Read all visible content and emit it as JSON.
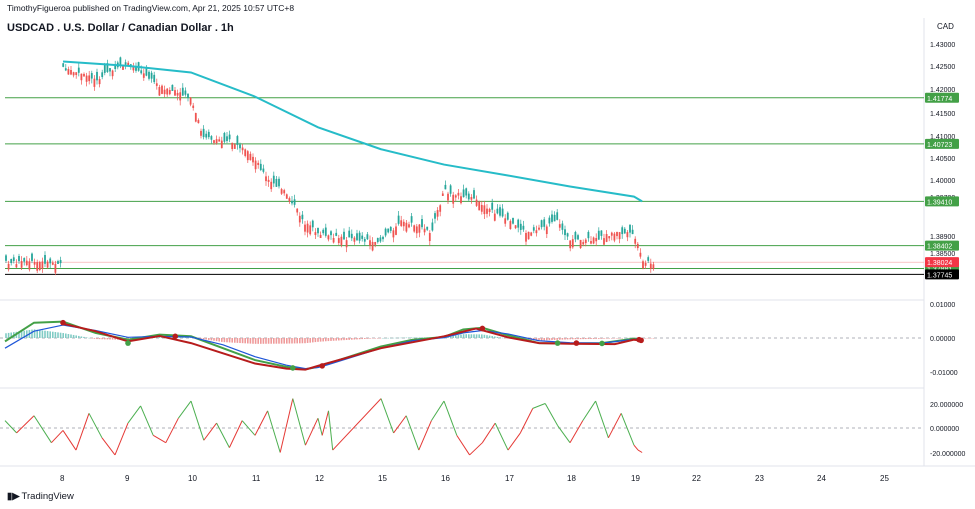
{
  "header": {
    "publisher": "TimothyFigueroa published on TradingView.com, Apr 21, 2025 10:57 UTC+8",
    "title": "USDCAD . U.S. Dollar / Canadian Dollar . 1h",
    "currency": "CAD",
    "brand": "TradingView"
  },
  "colors": {
    "up": "#26a69a",
    "down": "#ef5350",
    "ma": "#26bcc8",
    "level": "#43a047",
    "last": "#f23645",
    "rsi_up": "#4caf50",
    "rsi_down": "#e53935"
  },
  "chart_data": [
    {
      "type": "candlestick",
      "title": "USDCAD . U.S. Dollar / Canadian Dollar . 1h",
      "x_tick_labels": [
        "8",
        "9",
        "10",
        "11",
        "12",
        "15",
        "16",
        "17",
        "18",
        "19",
        "22",
        "23",
        "24",
        "25"
      ],
      "y_tick_labels": [
        "1.43000",
        "1.42500",
        "1.42000",
        "1.41500",
        "1.41000",
        "1.40500",
        "1.40000",
        "1.39700",
        "1.38900",
        "1.38500",
        "1.37800"
      ],
      "ylim": [
        1.3765,
        1.4315
      ],
      "close_path": [
        [
          "8",
          1.4245
        ],
        [
          "8.5",
          1.422
        ],
        [
          "9",
          1.4255
        ],
        [
          "9.5",
          1.4205
        ],
        [
          "10",
          1.4175
        ],
        [
          "10.2",
          1.4085
        ],
        [
          "10.6",
          1.408
        ],
        [
          "11",
          1.404
        ],
        [
          "11.2",
          1.399
        ],
        [
          "11.5",
          1.396
        ],
        [
          "11.8",
          1.389
        ],
        [
          "12",
          1.387
        ],
        [
          "12.5",
          1.386
        ],
        [
          "15",
          1.385
        ],
        [
          "15.3",
          1.3895
        ],
        [
          "15.6",
          1.3885
        ],
        [
          "15.8",
          1.387
        ],
        [
          "16",
          1.3965
        ],
        [
          "16.3",
          1.3955
        ],
        [
          "16.6",
          1.3935
        ],
        [
          "17",
          1.3895
        ],
        [
          "17.3",
          1.387
        ],
        [
          "17.8",
          1.3895
        ],
        [
          "18",
          1.385
        ],
        [
          "18.4",
          1.3855
        ],
        [
          "18.7",
          1.387
        ],
        [
          "19",
          1.3865
        ],
        [
          "19.3",
          1.3825
        ],
        [
          "19.4",
          1.3802
        ]
      ],
      "moving_average": [
        [
          "8",
          1.426
        ],
        [
          "9",
          1.425
        ],
        [
          "10",
          1.4235
        ],
        [
          "11",
          1.418
        ],
        [
          "12",
          1.411
        ],
        [
          "15",
          1.406
        ],
        [
          "16",
          1.4025
        ],
        [
          "17",
          1.4
        ],
        [
          "18",
          1.3975
        ],
        [
          "19",
          1.3952
        ],
        [
          "19.4",
          1.3941
        ]
      ],
      "horizontal_levels": [
        {
          "label": "1.41774",
          "value": 1.41774
        },
        {
          "label": "1.40723",
          "value": 1.40723
        },
        {
          "label": "1.39410",
          "value": 1.3941
        },
        {
          "label": "1.38402",
          "value": 1.38402
        },
        {
          "label": "1.37881",
          "value": 1.37881
        },
        {
          "label": "1.37745",
          "value": 1.37745
        }
      ],
      "last_price": {
        "label": "1.38024",
        "value": 1.38024
      }
    },
    {
      "type": "line",
      "name": "oscillator",
      "y_tick_labels": [
        "0.01000",
        "0.00000",
        "-0.01000"
      ],
      "ylim": [
        -0.0125,
        0.0115
      ],
      "series": [
        {
          "name": "fast",
          "color": "#43a047",
          "values": [
            [
              "7",
              -0.001
            ],
            [
              "7.5",
              0.0045
            ],
            [
              "8",
              0.0048
            ],
            [
              "8.5",
              0.0015
            ],
            [
              "9",
              -0.0005
            ],
            [
              "9.5",
              0.001
            ],
            [
              "10",
              0.0005
            ],
            [
              "10.5",
              -0.003
            ],
            [
              "11",
              -0.0065
            ],
            [
              "11.5",
              -0.0085
            ],
            [
              "11.8",
              -0.0092
            ],
            [
              "12",
              -0.0085
            ],
            [
              "12.5",
              -0.0075
            ],
            [
              "15",
              -0.0025
            ],
            [
              "15.5",
              -0.0005
            ],
            [
              "16",
              0.0003
            ],
            [
              "16.3",
              0.0025
            ],
            [
              "16.6",
              0.003
            ],
            [
              "17",
              0.0008
            ],
            [
              "17.5",
              -0.0015
            ],
            [
              "18",
              -0.0016
            ],
            [
              "18.5",
              -0.0015
            ],
            [
              "19",
              -0.0002
            ],
            [
              "19.4",
              -0.0005
            ]
          ]
        },
        {
          "name": "slow",
          "color": "#1e56d8",
          "values": [
            [
              "7",
              -0.003
            ],
            [
              "7.5",
              0.002
            ],
            [
              "8",
              0.0038
            ],
            [
              "8.5",
              0.0022
            ],
            [
              "9",
              0.0002
            ],
            [
              "9.5",
              0.0005
            ],
            [
              "10",
              0.0003
            ],
            [
              "10.5",
              -0.002
            ],
            [
              "11",
              -0.0055
            ],
            [
              "11.5",
              -0.008
            ],
            [
              "11.8",
              -0.009
            ],
            [
              "12",
              -0.0087
            ],
            [
              "12.5",
              -0.0078
            ],
            [
              "15",
              -0.003
            ],
            [
              "15.5",
              -0.0008
            ],
            [
              "16",
              0.0001
            ],
            [
              "16.3",
              0.0015
            ],
            [
              "16.6",
              0.0022
            ],
            [
              "17",
              0.0012
            ],
            [
              "17.5",
              -0.0008
            ],
            [
              "18",
              -0.0014
            ],
            [
              "18.5",
              -0.0015
            ],
            [
              "19",
              -0.0004
            ],
            [
              "19.4",
              -0.0004
            ]
          ]
        },
        {
          "name": "signal",
          "color": "#b71c1c",
          "values": [
            [
              "8",
              0.0042
            ],
            [
              "8.5",
              0.002
            ],
            [
              "9",
              -0.001
            ],
            [
              "9.5",
              0.0006
            ],
            [
              "10",
              -0.0015
            ],
            [
              "10.5",
              -0.0045
            ],
            [
              "11",
              -0.0075
            ],
            [
              "11.5",
              -0.009
            ],
            [
              "11.8",
              -0.0093
            ],
            [
              "12",
              -0.0082
            ],
            [
              "15",
              -0.003
            ],
            [
              "16",
              0.0005
            ],
            [
              "16.5",
              0.0028
            ],
            [
              "17",
              0.0002
            ],
            [
              "17.5",
              -0.0015
            ],
            [
              "18",
              -0.0017
            ],
            [
              "18.7",
              -0.0018
            ],
            [
              "19",
              -0.0005
            ],
            [
              "19.4",
              -0.0008
            ]
          ]
        }
      ]
    },
    {
      "type": "line",
      "name": "momentum",
      "y_tick_labels": [
        "20.000000",
        "0.000000",
        "-20.000000"
      ],
      "ylim": [
        -28,
        32
      ],
      "values": [
        [
          "7",
          6
        ],
        [
          "7.2",
          -4
        ],
        [
          "7.5",
          10
        ],
        [
          "7.8",
          -12
        ],
        [
          "8",
          -2
        ],
        [
          "8.2",
          -18
        ],
        [
          "8.4",
          12
        ],
        [
          "8.6",
          -8
        ],
        [
          "8.8",
          -22
        ],
        [
          "9",
          4
        ],
        [
          "9.2",
          18
        ],
        [
          "9.4",
          -6
        ],
        [
          "9.6",
          -12
        ],
        [
          "9.8",
          8
        ],
        [
          "10",
          22
        ],
        [
          "10.2",
          -10
        ],
        [
          "10.4",
          4
        ],
        [
          "10.6",
          -16
        ],
        [
          "10.8",
          6
        ],
        [
          "11",
          -6
        ],
        [
          "11.2",
          14
        ],
        [
          "11.4",
          -20
        ],
        [
          "11.6",
          24
        ],
        [
          "11.8",
          -14
        ],
        [
          "12",
          8
        ],
        [
          "12.2",
          -6
        ],
        [
          "12.5",
          14
        ],
        [
          "12.7",
          -18
        ],
        [
          "15",
          24
        ],
        [
          "15.2",
          -4
        ],
        [
          "15.4",
          10
        ],
        [
          "15.6",
          -18
        ],
        [
          "15.8",
          6
        ],
        [
          "16",
          22
        ],
        [
          "16.2",
          -6
        ],
        [
          "16.4",
          -22
        ],
        [
          "16.6",
          -12
        ],
        [
          "16.8",
          4
        ],
        [
          "17",
          -18
        ],
        [
          "17.2",
          -4
        ],
        [
          "17.4",
          16
        ],
        [
          "17.6",
          20
        ],
        [
          "17.8",
          2
        ],
        [
          "18",
          -12
        ],
        [
          "18.2",
          6
        ],
        [
          "18.4",
          22
        ],
        [
          "18.6",
          -8
        ],
        [
          "18.8",
          12
        ],
        [
          "19",
          -14
        ],
        [
          "19.2",
          -18
        ],
        [
          "19.4",
          -20
        ]
      ]
    }
  ]
}
